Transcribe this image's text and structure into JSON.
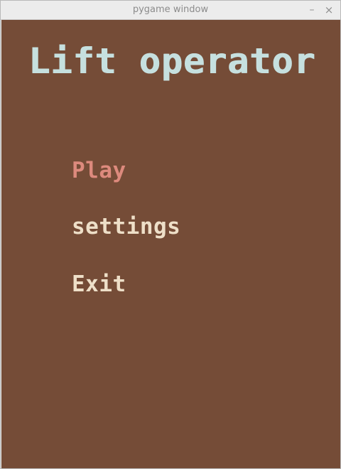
{
  "window": {
    "title": "pygame window",
    "minimize_glyph": "–",
    "close_glyph": "×"
  },
  "game": {
    "title": "Lift operator",
    "menu": {
      "items": [
        {
          "label": "Play",
          "selected": true
        },
        {
          "label": "settings",
          "selected": false
        },
        {
          "label": "Exit",
          "selected": false
        }
      ]
    }
  },
  "colors": {
    "background": "#754c37",
    "title_text": "#c6e0df",
    "menu_selected": "#dd8a7d",
    "menu_default": "#eedfc8"
  }
}
